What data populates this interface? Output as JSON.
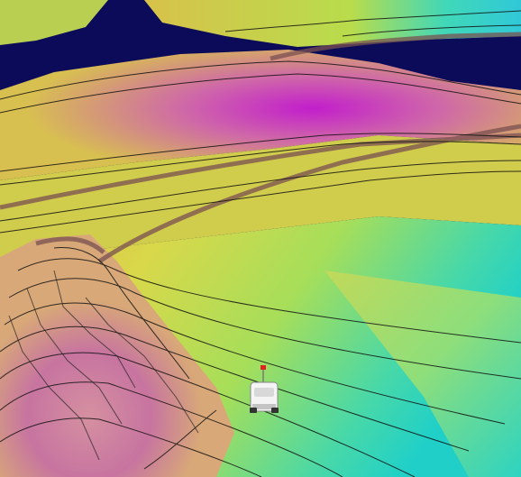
{
  "viewport": {
    "sky_color": "#0b0b5a",
    "contour_line_color": "#111111",
    "haul_road_color": "#6b4a4a"
  },
  "terrain_colormap": {
    "description_level": "elevation",
    "stops": [
      "#20d2c8",
      "#7ee07a",
      "#cfe04a",
      "#e3c43a",
      "#d48c6a",
      "#c96a9a",
      "#c020c8"
    ]
  },
  "vehicle": {
    "icon": "haul-truck-icon",
    "body_color": "#f4f4f4",
    "flag_color": "#e52020"
  }
}
